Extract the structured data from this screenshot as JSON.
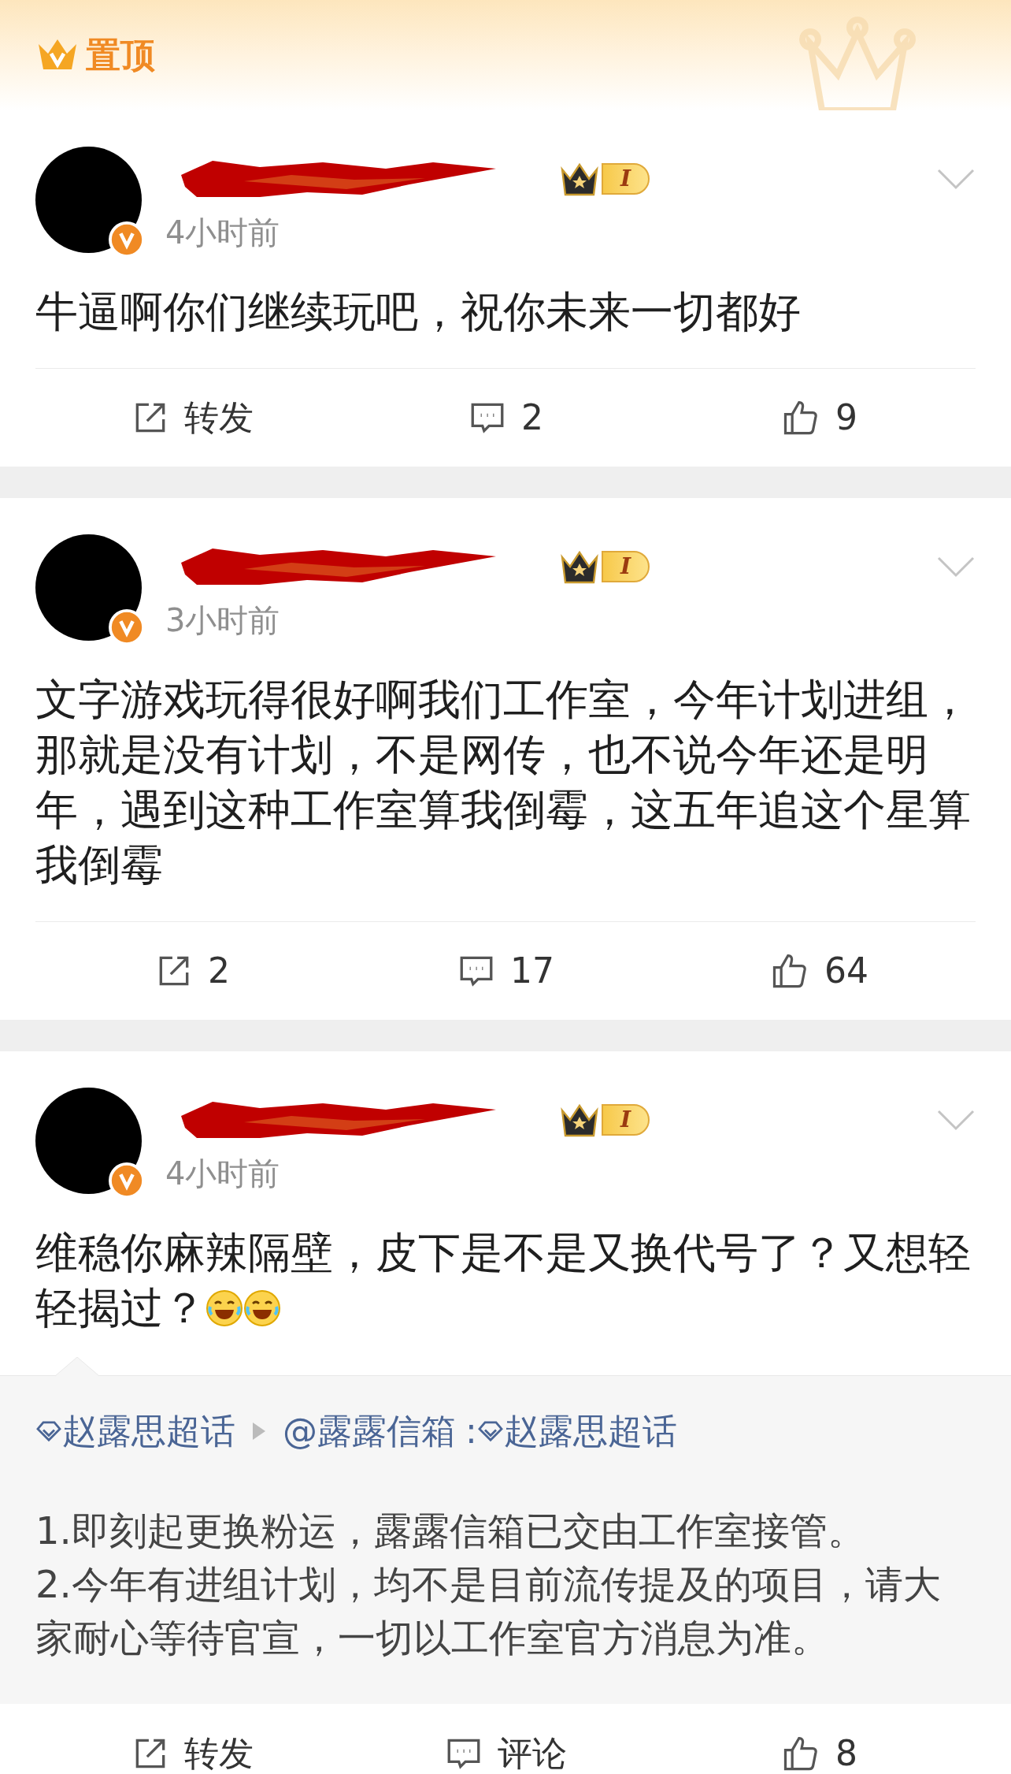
{
  "pinned_header": {
    "label": "置顶"
  },
  "posts": [
    {
      "time": "4小时前",
      "level_badge": "I",
      "content_lines": [
        "牛逼啊你们继续玩吧，祝你未来一切都好"
      ],
      "actions": [
        {
          "kind": "share",
          "label": "转发"
        },
        {
          "kind": "comment",
          "label": "2"
        },
        {
          "kind": "like",
          "label": "9"
        }
      ]
    },
    {
      "time": "3小时前",
      "level_badge": "I",
      "content_lines": [
        "文字游戏玩得很好啊我们工作室，今年计划进组，",
        "那就是没有计划，不是网传，也不说今年还是明",
        "年，遇到这种工作室算我倒霉，这五年追这个星算",
        "我倒霉"
      ],
      "actions": [
        {
          "kind": "share",
          "label": "2"
        },
        {
          "kind": "comment",
          "label": "17"
        },
        {
          "kind": "like",
          "label": "64"
        }
      ]
    },
    {
      "time": "4小时前",
      "level_badge": "I",
      "content_lines": [
        "维稳你麻辣隔壁，皮下是不是又换代号了？又想轻",
        "轻揭过？"
      ],
      "emoji_icons": [
        {
          "kind": "laugh"
        },
        {
          "kind": "laugh"
        }
      ],
      "repost": {
        "topic": "赵露思超话",
        "author": "@露露信箱",
        "separator": ":",
        "topic_2": "赵露思超话",
        "body_lines": [
          "1.即刻起更换粉运，露露信箱已交由工作室接管。",
          "2.今年有进组计划，均不是目前流传提及的项目，请大",
          "家耐心等待官宣，一切以工作室官方消息为准。"
        ]
      },
      "actions": [
        {
          "kind": "share",
          "label": "转发"
        },
        {
          "kind": "comment",
          "label": "评论"
        },
        {
          "kind": "like",
          "label": "8"
        }
      ]
    }
  ]
}
